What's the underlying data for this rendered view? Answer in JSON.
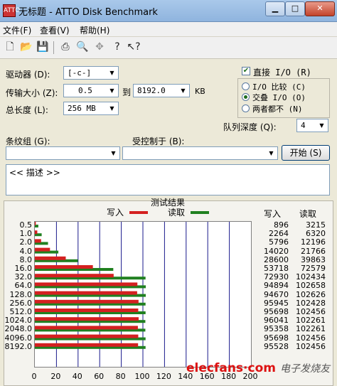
{
  "window": {
    "title": "无标题 - ATTO Disk Benchmark",
    "icon_text": "ATTO"
  },
  "menu": [
    "文件(F)",
    "查看(V)",
    "帮助(H)"
  ],
  "toolbar_icons": [
    "new-file-icon",
    "open-folder-icon",
    "save-icon",
    "print-icon",
    "print-preview-icon",
    "move-icon",
    "help-icon",
    "context-help-icon"
  ],
  "form": {
    "drive_label": "驱动器 (D):",
    "drive_value": "[-c-]",
    "transfer_label": "传输大小 (Z):",
    "transfer_from": "0.5",
    "to_label": "到",
    "transfer_to": "8192.0",
    "unit": "KB",
    "length_label": "总长度 (L):",
    "length_value": "256 MB",
    "direct_io_label": "直接 I/O (R)",
    "direct_io_checked": true,
    "io_compare_label": "I/O 比较 (C)",
    "overlapped_io_label": "交叠 I/O (O)",
    "neither_label": "两者都不 (N)",
    "selected_option": "overlapped_io",
    "queue_depth_label": "队列深度 (Q):",
    "queue_depth_value": "4",
    "stripe_label": "条纹组 (G):",
    "stripe_value": "",
    "controlled_by_label": "受控制于 (B):",
    "controlled_by_value": "",
    "start_button": "开始 (S)",
    "description": "<< 描述 >>"
  },
  "results": {
    "title": "测试结果",
    "write_legend": "写入",
    "read_legend": "读取",
    "write_col": "写入",
    "read_col": "读取"
  },
  "colors": {
    "write": "#d42020",
    "read": "#208020"
  },
  "chart_data": {
    "type": "bar",
    "orientation": "horizontal",
    "title": "测试结果",
    "categories": [
      "0.5",
      "1.0",
      "2.0",
      "4.0",
      "8.0",
      "16.0",
      "32.0",
      "64.0",
      "128.0",
      "256.0",
      "512.0",
      "1024.0",
      "2048.0",
      "4096.0",
      "8192.0"
    ],
    "series": [
      {
        "name": "写入",
        "values": [
          896,
          2264,
          5796,
          14020,
          28600,
          53718,
          72930,
          94894,
          94670,
          95945,
          95698,
          96041,
          95358,
          95698,
          95528
        ]
      },
      {
        "name": "读取",
        "values": [
          3215,
          6320,
          12196,
          21766,
          39863,
          72579,
          102434,
          102658,
          102626,
          102428,
          102456,
          102261,
          102261,
          102456,
          102456
        ]
      }
    ],
    "x_ticks": [
      "0",
      "20",
      "40",
      "60",
      "80",
      "100",
      "120",
      "140",
      "160",
      "180",
      "200"
    ],
    "xlim": [
      0,
      200
    ],
    "x_scale_per_unit": 1000,
    "grid": true
  },
  "watermark": {
    "text": "elecfans·com",
    "cn": "电子发烧友"
  }
}
